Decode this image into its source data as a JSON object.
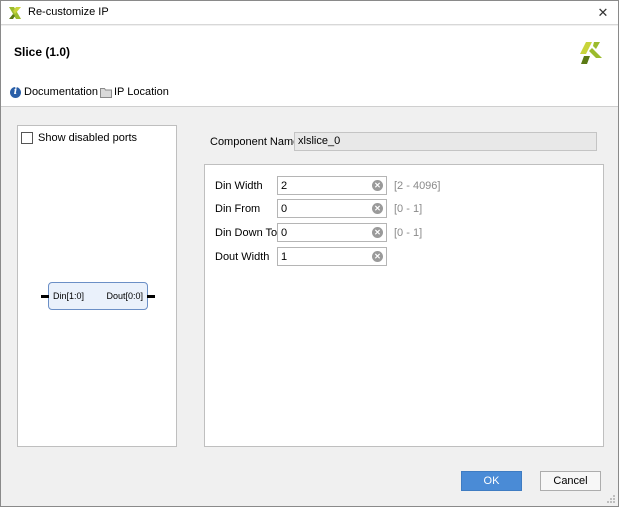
{
  "window": {
    "title": "Re-customize IP",
    "close_glyph": "✕",
    "logo_icon": "xilinx-logo-icon"
  },
  "header": {
    "title": "Slice (1.0)",
    "links": [
      {
        "label": "Documentation",
        "icon": "info-icon"
      },
      {
        "label": "IP Location",
        "icon": "folder-icon"
      }
    ]
  },
  "symbol_panel": {
    "checkbox_label": "Show disabled ports",
    "checkbox_checked": false,
    "block": {
      "input_port": "Din[1:0]",
      "output_port": "Dout[0:0]"
    }
  },
  "component": {
    "label": "Component Name",
    "value": "xlslice_0"
  },
  "params": [
    {
      "label": "Din Width",
      "value": "2",
      "range": "[2 - 4096]"
    },
    {
      "label": "Din From",
      "value": "0",
      "range": "[0 - 1]"
    },
    {
      "label": "Din Down To",
      "value": "0",
      "range": "[0 - 1]"
    },
    {
      "label": "Dout Width",
      "value": "1",
      "range": ""
    }
  ],
  "buttons": {
    "ok": "OK",
    "cancel": "Cancel"
  },
  "colors": {
    "accent": "#4a8bd6",
    "logo": "#9bbb2c",
    "logo_dark": "#5b7a14"
  }
}
